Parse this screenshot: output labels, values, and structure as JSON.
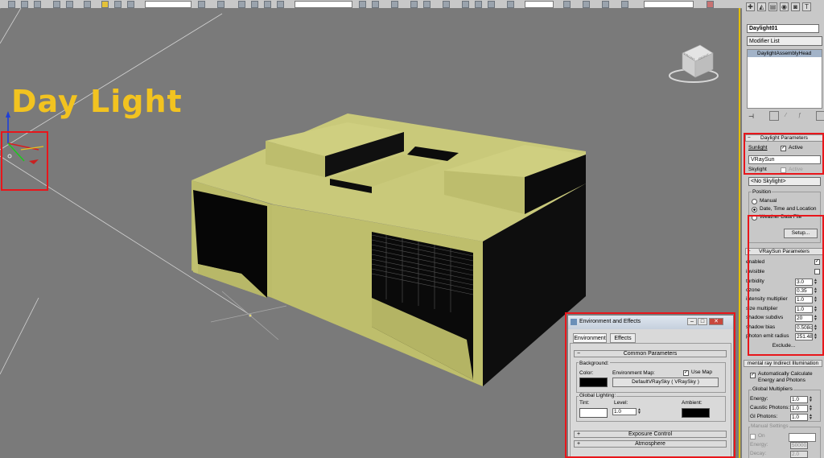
{
  "viewport": {
    "overlay_title": "Day Light",
    "viewcube_front": "FRONT",
    "viewcube_right": "RIGHT"
  },
  "command_panel": {
    "object_name": "Daylight01",
    "modifier_list": "Modifier List",
    "stack_item": "DaylightAssemblyHead",
    "daylight_params": {
      "title": "Daylight Parameters",
      "sunlight_label": "Sunlight",
      "active_label": "Active",
      "sunlight_type": "VRaySun",
      "skylight_label": "Skylight",
      "skylight_active_label": "Active",
      "skylight_type": "<No Skylight>",
      "position_label": "Position",
      "manual": "Manual",
      "date_time_location": "Date, Time and Location",
      "weather_file": "Weather Data File",
      "setup_button": "Setup..."
    },
    "vraysun_params": {
      "title": "VRaySun Parameters",
      "enabled": "enabled",
      "invisible": "invisible",
      "turbidity": "turbidity",
      "turbidity_value": "3.0",
      "ozone": "ozone",
      "ozone_value": "0.35",
      "intensity": "intensity multiplier",
      "intensity_value": "1.0",
      "size": "size multiplier",
      "size_value": "1.0",
      "shadow_subdivs": "shadow subdivs",
      "shadow_subdivs_value": "20",
      "shadow_bias": "shadow bias",
      "shadow_bias_value": "0.508c",
      "photon_radius": "photon emit radius",
      "photon_radius_value": "251.48",
      "exclude_button": "Exclude..."
    },
    "mental_ray": {
      "title": "mental ray Indirect Illumination",
      "auto_calc": "Automatically Calculate Energy and Photons",
      "global_mult": "Global Multipliers",
      "energy": "Energy:",
      "energy_value": "1.0",
      "caustic": "Caustic Photons:",
      "caustic_value": "1.0",
      "gi": "GI Photons:",
      "gi_value": "1.0",
      "manual_settings": "Manual Settings",
      "on": "On",
      "energy2": "Energy:",
      "energy2_value": "50000.0",
      "decay": "Decay:",
      "decay_value": "2.0"
    }
  },
  "env_dialog": {
    "title": "Environment and Effects",
    "tab_environment": "Environment",
    "tab_effects": "Effects",
    "common_params": "Common Parameters",
    "background": "Background:",
    "color": "Color:",
    "env_map": "Environment Map:",
    "use_map": "Use Map",
    "map_button": "DefaultVRaySky ( VRaySky )",
    "global_lighting": "Global Lighting:",
    "tint": "Tint:",
    "level": "Level:",
    "level_value": "1.0",
    "ambient": "Ambient:",
    "exposure": "Exposure Control",
    "atmosphere": "Atmosphere"
  },
  "colors": {
    "viewport_bg": "#7a7a7a",
    "building": "#c9c97a",
    "highlight": "#e8161b",
    "title_text": "#f2c320",
    "active_border": "#e5c000"
  }
}
